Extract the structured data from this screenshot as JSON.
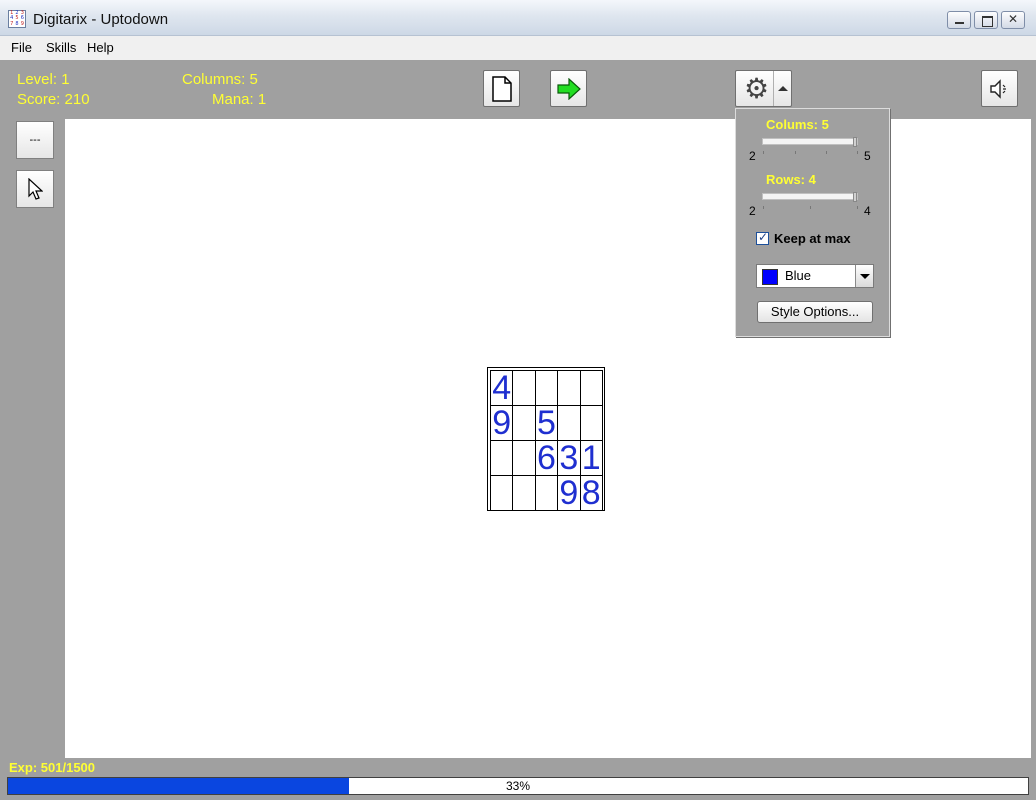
{
  "window": {
    "title": "Digitarix - Uptodown"
  },
  "menu": [
    {
      "label": "File"
    },
    {
      "label": "Skills"
    },
    {
      "label": "Help"
    }
  ],
  "stats": {
    "level": "Level: 1",
    "score": "Score: 210",
    "columns": "Columns: 5",
    "mana": "Mana: 1"
  },
  "toolbar": {
    "new_game_icon": "new-page-icon",
    "next_icon": "green-arrow-icon",
    "settings_icon": "gear-icon",
    "sound_icon": "speaker-muted-icon"
  },
  "sidebar": {
    "dots_label": "---",
    "pointer_icon": "cursor-arrow-icon"
  },
  "grid": {
    "rows": [
      [
        "4",
        "",
        "",
        "",
        ""
      ],
      [
        "9",
        "",
        "5",
        "",
        ""
      ],
      [
        "",
        "",
        "6",
        "3",
        "1"
      ],
      [
        "",
        "",
        "",
        "9",
        "8"
      ]
    ],
    "digit_color": "#1f2fd0"
  },
  "popup": {
    "columns_heading": "Colums: 5",
    "columns_min": "2",
    "columns_max": "5",
    "columns_value": 5,
    "rows_heading": "Rows: 4",
    "rows_min": "2",
    "rows_max": "4",
    "rows_value": 4,
    "keep_at_max_label": "Keep at max",
    "keep_at_max_checked": true,
    "color_label": "Blue",
    "color_swatch": "#0000ff",
    "style_button": "Style Options..."
  },
  "status": {
    "exp_label": "Exp: 501/1500",
    "progress_text": "33%",
    "progress_value": 0.334,
    "progress_color": "#0a46e0"
  }
}
